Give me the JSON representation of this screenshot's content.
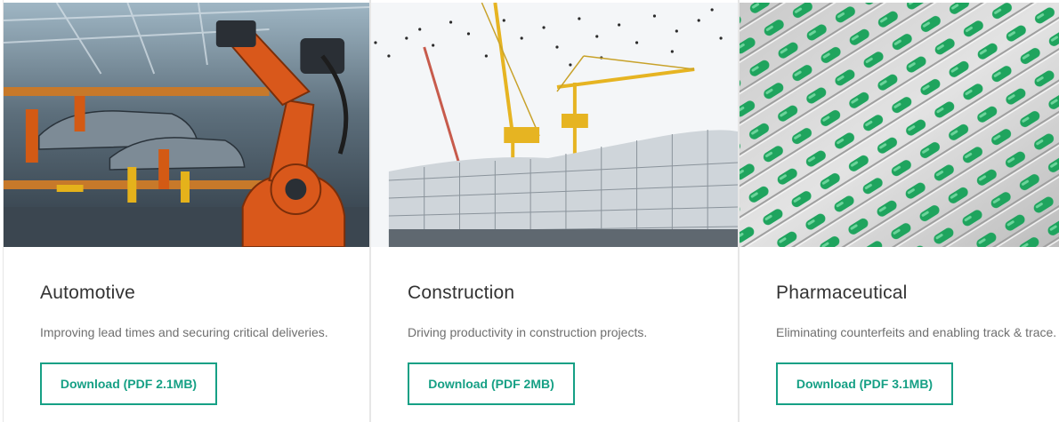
{
  "cards": [
    {
      "image_name": "automotive-robot-factory-image",
      "title": "Automotive",
      "description": "Improving lead times and securing critical deliveries.",
      "button_label": "Download (PDF 2.1MB)"
    },
    {
      "image_name": "construction-cranes-image",
      "title": "Construction",
      "description": "Driving productivity in construction projects.",
      "button_label": "Download (PDF 2MB)"
    },
    {
      "image_name": "pharmaceutical-capsules-image",
      "title": "Pharmaceutical",
      "description": "Eliminating counterfeits and enabling track & trace.",
      "button_label": "Download (PDF 3.1MB)"
    }
  ],
  "colors": {
    "accent": "#16a085",
    "title": "#333333",
    "description": "#6f6f6f",
    "card_border": "#e6e6e6"
  }
}
